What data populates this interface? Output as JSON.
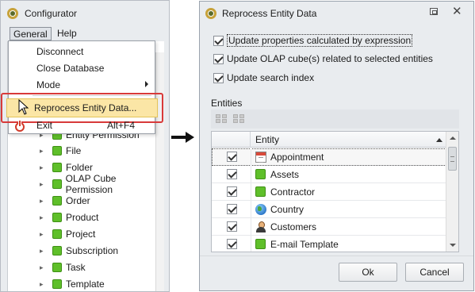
{
  "configurator": {
    "title": "Configurator",
    "menubar": {
      "general": "General",
      "help": "Help"
    },
    "dropdown": {
      "items": [
        "Disconnect",
        "Close Database",
        "Mode"
      ],
      "highlighted": "Reprocess Entity Data...",
      "exit_label": "Exit",
      "exit_shortcut": "Alt+F4"
    },
    "tree_items": [
      "Entity Permission",
      "File",
      "Folder",
      "OLAP Cube Permission",
      "Order",
      "Product",
      "Project",
      "Subscription",
      "Task",
      "Template"
    ]
  },
  "dialog": {
    "title": "Reprocess Entity Data",
    "options": [
      {
        "label": "Update properties calculated by expression",
        "checked": true
      },
      {
        "label": "Update OLAP cube(s) related to selected entities",
        "checked": true
      },
      {
        "label": "Update search index",
        "checked": true
      }
    ],
    "entities_label": "Entities",
    "grid": {
      "column": "Entity",
      "rows": [
        {
          "label": "Appointment",
          "icon": "calendar-icon",
          "checked": true
        },
        {
          "label": "Assets",
          "icon": "green-square-icon",
          "checked": true
        },
        {
          "label": "Contractor",
          "icon": "green-square-icon",
          "checked": true
        },
        {
          "label": "Country",
          "icon": "globe-icon",
          "checked": true
        },
        {
          "label": "Customers",
          "icon": "person-icon",
          "checked": true
        },
        {
          "label": "E-mail Template",
          "icon": "green-square-icon",
          "checked": true
        }
      ]
    },
    "ok_label": "Ok",
    "cancel_label": "Cancel"
  },
  "colors": {
    "highlight_frame": "#d83a3a",
    "menu_highlight": "#fbe6a6",
    "entity_green": "#5fbf2a"
  }
}
